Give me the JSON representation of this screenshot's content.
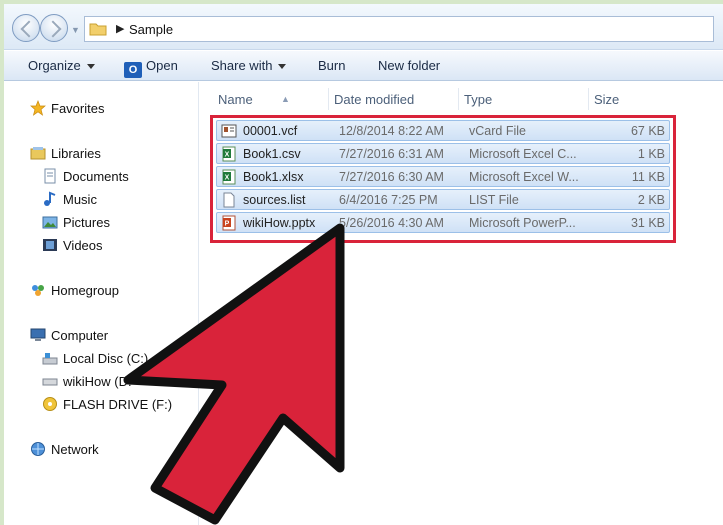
{
  "address": {
    "path": "Sample"
  },
  "toolbar": {
    "organize": "Organize",
    "open": "Open",
    "share": "Share with",
    "burn": "Burn",
    "new_folder": "New folder"
  },
  "sidebar": {
    "favorites": "Favorites",
    "libraries": "Libraries",
    "documents": "Documents",
    "music": "Music",
    "pictures": "Pictures",
    "videos": "Videos",
    "homegroup": "Homegroup",
    "computer": "Computer",
    "local_disc": "Local Disc (C:)",
    "wikihow_drive": "wikiHow (D:",
    "flash_drive": "FLASH DRIVE (F:)",
    "network": "Network"
  },
  "columns": {
    "name": "Name",
    "date": "Date modified",
    "type": "Type",
    "size": "Size"
  },
  "files": [
    {
      "name": "00001.vcf",
      "date": "12/8/2014 8:22 AM",
      "type": "vCard File",
      "size": "67 KB",
      "icon": "vcard-icon"
    },
    {
      "name": "Book1.csv",
      "date": "7/27/2016 6:31 AM",
      "type": "Microsoft Excel C...",
      "size": "1 KB",
      "icon": "excel-icon"
    },
    {
      "name": "Book1.xlsx",
      "date": "7/27/2016 6:30 AM",
      "type": "Microsoft Excel W...",
      "size": "11 KB",
      "icon": "excel-icon"
    },
    {
      "name": "sources.list",
      "date": "6/4/2016 7:25 PM",
      "type": "LIST File",
      "size": "2 KB",
      "icon": "blank-file-icon"
    },
    {
      "name": "wikiHow.pptx",
      "date": "5/26/2016 4:30 AM",
      "type": "Microsoft PowerP...",
      "size": "31 KB",
      "icon": "powerpoint-icon"
    }
  ],
  "colors": {
    "highlight_border": "#d9233a",
    "arrow_fill": "#d9233a",
    "selection": "#cfe1f6"
  }
}
